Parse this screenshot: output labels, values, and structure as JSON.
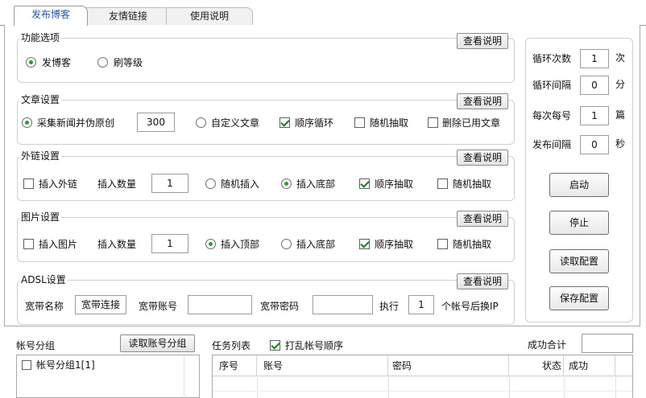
{
  "tabs": [
    {
      "label": "发布博客"
    },
    {
      "label": "友情链接"
    },
    {
      "label": "使用说明"
    }
  ],
  "view_doc_label": "查看说明",
  "func": {
    "title": "功能选项",
    "opt_blog": "发博客",
    "opt_level": "刷等级"
  },
  "article": {
    "title": "文章设置",
    "collect_label": "采集新闻并伪原创",
    "collect_count": "300",
    "custom_label": "自定义文章",
    "seq_loop_label": "顺序循环",
    "random_pick_label": "随机抽取",
    "delete_used_label": "删除已用文章"
  },
  "links": {
    "title": "外链设置",
    "insert_label": "插入外链",
    "count_label": "插入数量",
    "count_value": "1",
    "random_insert_label": "随机插入",
    "insert_bottom_label": "插入底部",
    "seq_pick_label": "顺序抽取",
    "random_pick_label": "随机抽取"
  },
  "images": {
    "title": "图片设置",
    "insert_label": "插入图片",
    "count_label": "插入数量",
    "count_value": "1",
    "insert_top_label": "插入顶部",
    "insert_bottom_label": "插入底部",
    "seq_pick_label": "顺序抽取",
    "random_pick_label": "随机抽取"
  },
  "adsl": {
    "title": "ADSL设置",
    "name_label": "宽带名称",
    "name_value": "宽带连接",
    "account_label": "宽带账号",
    "account_value": "",
    "password_label": "宽带密码",
    "password_value": "",
    "exec_label": "执行",
    "exec_value": "1",
    "after_label": "个帐号后换IP"
  },
  "side": {
    "loop_count_label": "循环次数",
    "loop_count_value": "1",
    "loop_count_unit": "次",
    "loop_interval_label": "循环间隔",
    "loop_interval_value": "0",
    "loop_interval_unit": "分",
    "per_account_label": "每次每号",
    "per_account_value": "1",
    "per_account_unit": "篇",
    "publish_interval_label": "发布间隔",
    "publish_interval_value": "0",
    "publish_interval_unit": "秒",
    "start_label": "启动",
    "stop_label": "停止",
    "read_config_label": "读取配置",
    "save_config_label": "保存配置"
  },
  "accounts": {
    "title": "帐号分组",
    "read_button_label": "读取账号分组",
    "items": [
      {
        "label": "帐号分组1[1]"
      }
    ]
  },
  "tasks": {
    "title": "任务列表",
    "shuffle_label": "打乱帐号顺序",
    "success_total_label": "成功合计",
    "success_total_value": "",
    "columns": [
      "序号",
      "账号",
      "密码",
      "状态",
      "成功"
    ]
  }
}
